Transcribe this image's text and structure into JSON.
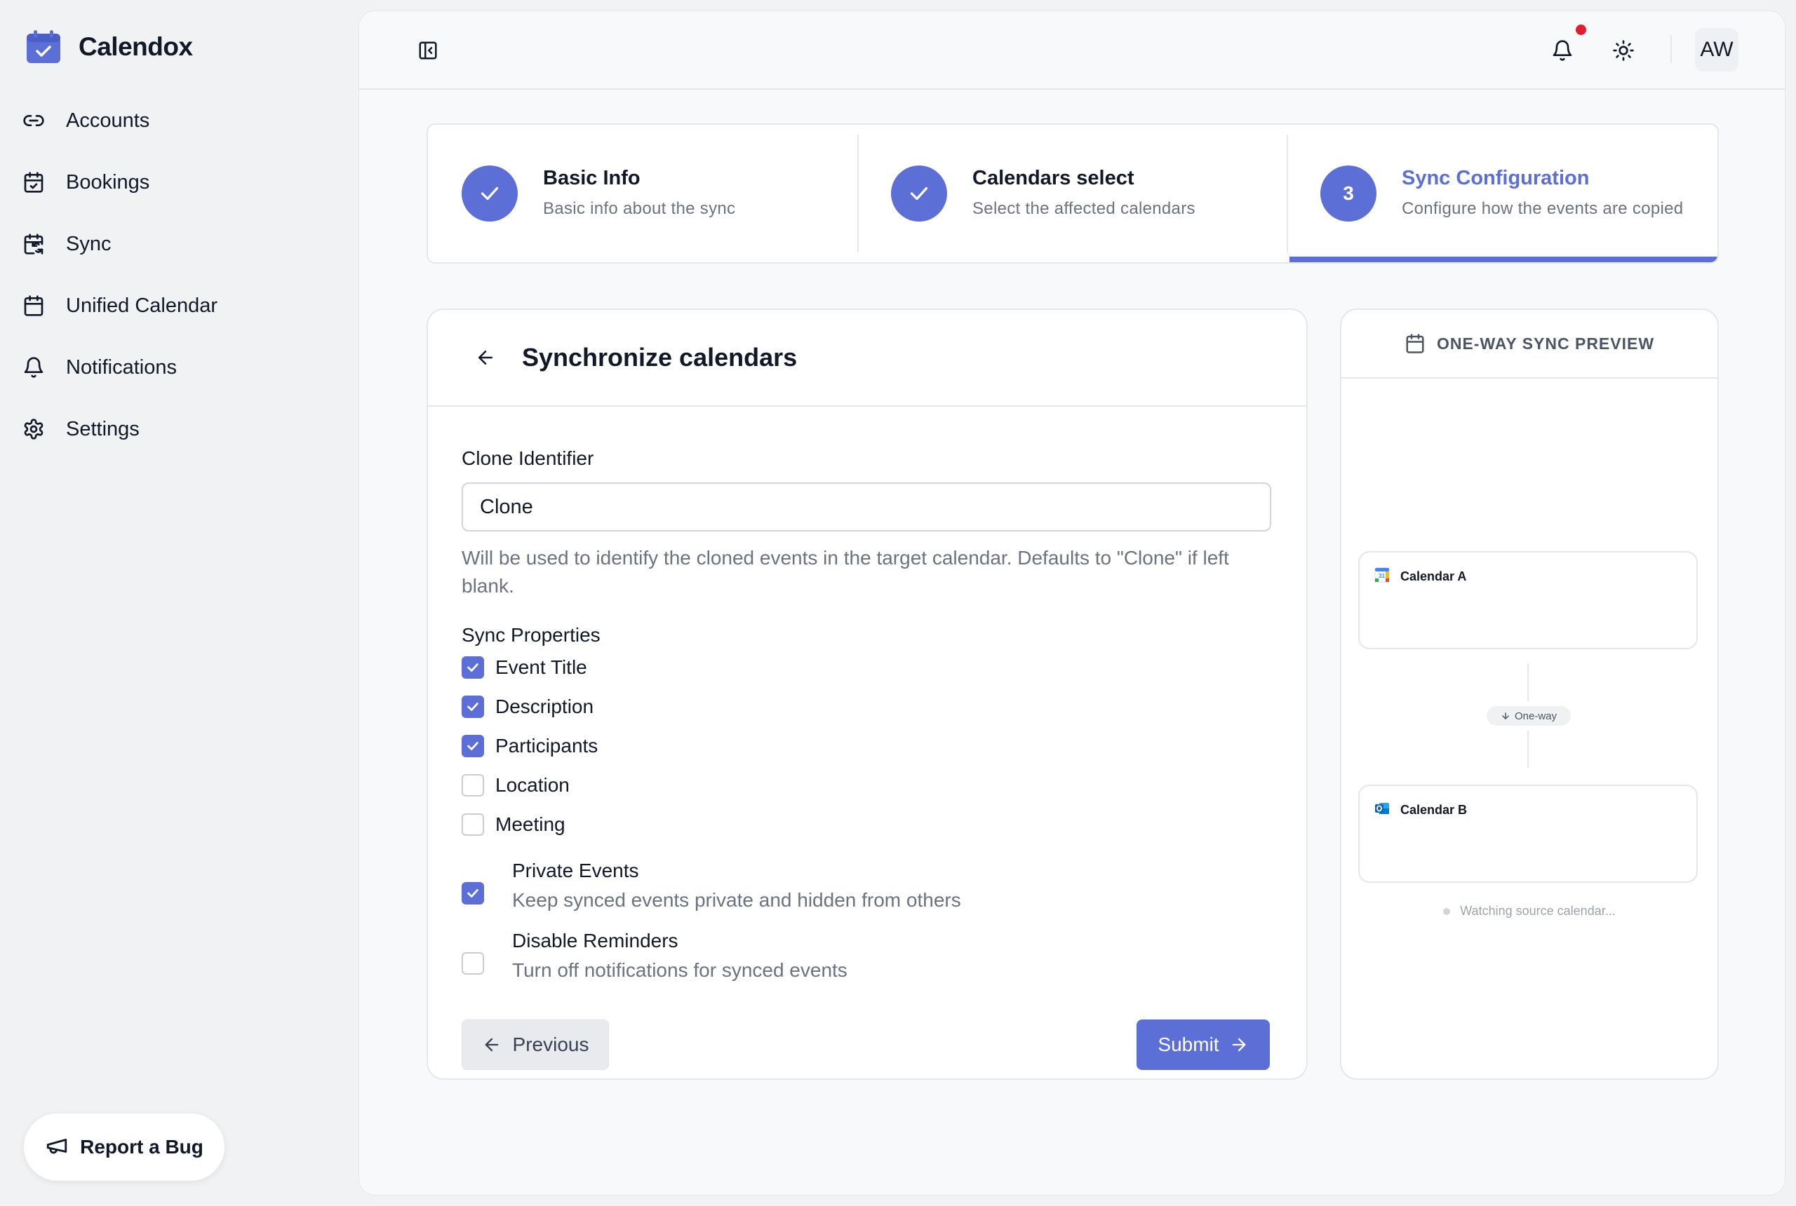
{
  "brand": {
    "name": "Calendox",
    "accent": "#5b6fd6"
  },
  "sidebar": {
    "items": [
      {
        "label": "Accounts",
        "icon": "link-icon"
      },
      {
        "label": "Bookings",
        "icon": "calendar-check-icon"
      },
      {
        "label": "Sync",
        "icon": "calendar-sync-icon"
      },
      {
        "label": "Unified Calendar",
        "icon": "calendar-icon"
      },
      {
        "label": "Notifications",
        "icon": "bell-icon"
      },
      {
        "label": "Settings",
        "icon": "gear-icon"
      }
    ],
    "report_bug": "Report a Bug"
  },
  "topbar": {
    "avatar_initials": "AW",
    "has_unread_notifications": true
  },
  "stepper": {
    "steps": [
      {
        "number": "1",
        "title": "Basic Info",
        "subtitle": "Basic info about the sync",
        "status": "complete"
      },
      {
        "number": "2",
        "title": "Calendars select",
        "subtitle": "Select the affected calendars",
        "status": "complete"
      },
      {
        "number": "3",
        "title": "Sync Configuration",
        "subtitle": "Configure how the events are copied",
        "status": "active"
      }
    ]
  },
  "form": {
    "title": "Synchronize calendars",
    "clone_label": "Clone Identifier",
    "clone_value": "Clone",
    "clone_help": "Will be used to identify the cloned events in the target calendar. Defaults to \"Clone\" if left blank.",
    "properties_label": "Sync Properties",
    "properties": [
      {
        "label": "Event Title",
        "checked": true
      },
      {
        "label": "Description",
        "checked": true
      },
      {
        "label": "Participants",
        "checked": true
      },
      {
        "label": "Location",
        "checked": false
      },
      {
        "label": "Meeting",
        "checked": false
      }
    ],
    "toggles": [
      {
        "title": "Private Events",
        "subtitle": "Keep synced events private and hidden from others",
        "checked": true
      },
      {
        "title": "Disable Reminders",
        "subtitle": "Turn off notifications for synced events",
        "checked": false
      }
    ],
    "previous_label": "Previous",
    "submit_label": "Submit"
  },
  "preview": {
    "title": "ONE-WAY SYNC PREVIEW",
    "source": {
      "name": "Calendar A",
      "provider_icon": "google-calendar-icon"
    },
    "target": {
      "name": "Calendar B",
      "provider_icon": "outlook-icon"
    },
    "direction_label": "One-way",
    "status_text": "Watching source calendar..."
  }
}
